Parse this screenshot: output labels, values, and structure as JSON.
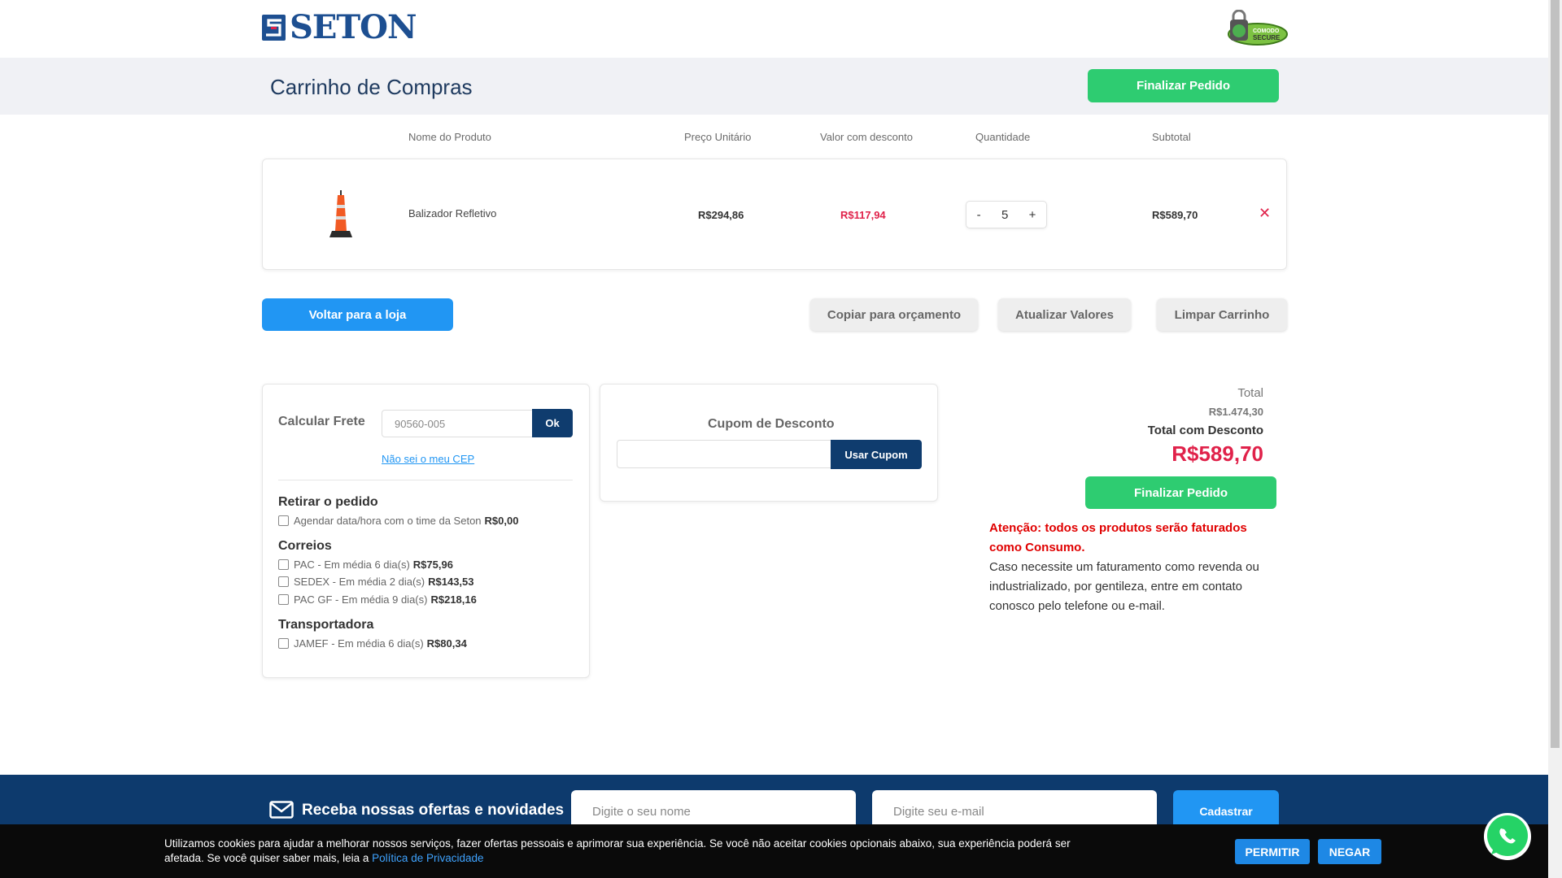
{
  "header": {
    "logo_text": "SETON",
    "secure_badge_line1": "COMODO",
    "secure_badge_line2": "SECURE",
    "page_title": "Carrinho de Compras",
    "finalize_label": "Finalizar Pedido"
  },
  "cart": {
    "columns": [
      "Nome do Produto",
      "Preço Unitário",
      "Valor com desconto",
      "Quantidade",
      "Subtotal"
    ],
    "items": [
      {
        "name": "Balizador Refletivo",
        "unit_price": "R$294,86",
        "discount_price": "R$117,94",
        "quantity": "5",
        "subtotal": "R$589,70"
      }
    ],
    "qty_minus": "-",
    "qty_plus": "+",
    "remove_symbol": "✕"
  },
  "actions": {
    "back": "Voltar para a loja",
    "copy_quote": "Copiar para orçamento",
    "update": "Atualizar Valores",
    "clear": "Limpar Carrinho"
  },
  "shipping": {
    "title": "Calcular Frete",
    "cep_value": "90560-005",
    "ok_label": "Ok",
    "cep_link": "Não sei o meu CEP",
    "groups": [
      {
        "title": "Retirar o pedido",
        "options": [
          {
            "label": "Agendar data/hora com o time da Seton",
            "price": "R$0,00"
          }
        ]
      },
      {
        "title": "Correios",
        "options": [
          {
            "label": "PAC - Em média 6 dia(s)",
            "price": "R$75,96"
          },
          {
            "label": "SEDEX - Em média 2 dia(s)",
            "price": "R$143,53"
          },
          {
            "label": "PAC GF - Em média 9 dia(s)",
            "price": "R$218,16"
          }
        ]
      },
      {
        "title": "Transportadora",
        "options": [
          {
            "label": "JAMEF - Em média 6 dia(s)",
            "price": "R$80,34"
          }
        ]
      }
    ]
  },
  "coupon": {
    "title": "Cupom de Desconto",
    "button": "Usar Cupom"
  },
  "totals": {
    "total_label": "Total",
    "total_value": "R$1.474,30",
    "discount_label": "Total com Desconto",
    "discount_value": "R$589,70",
    "finalize_label": "Finalizar Pedido",
    "warning": "Atenção: todos os produtos serão faturados como Consumo.",
    "info": "Caso necessite um faturamento como revenda ou industrializado, por gentileza, entre em contato conosco pelo telefone ou e-mail."
  },
  "newsletter": {
    "title": "Receba nossas ofertas e novidades",
    "name_placeholder": "Digite o seu nome",
    "email_placeholder": "Digite seu e-mail",
    "button": "Cadastrar"
  },
  "cookie": {
    "text": "Utilizamos cookies para ajudar a melhorar nossos serviços, fazer ofertas pessoais e aprimorar sua experiência. Se você não aceitar cookies opcionais abaixo, sua experiência poderá ser afetada. Se você quiser saber mais, leia a",
    "link": "Política de Privacidade",
    "allow": "PERMITIR",
    "deny": "NEGAR"
  },
  "colors": {
    "brand_blue": "#1d4f91",
    "navy": "#0d3a6d",
    "green": "#2ecc71",
    "blue": "#2196f3",
    "red": "#e0224a"
  }
}
